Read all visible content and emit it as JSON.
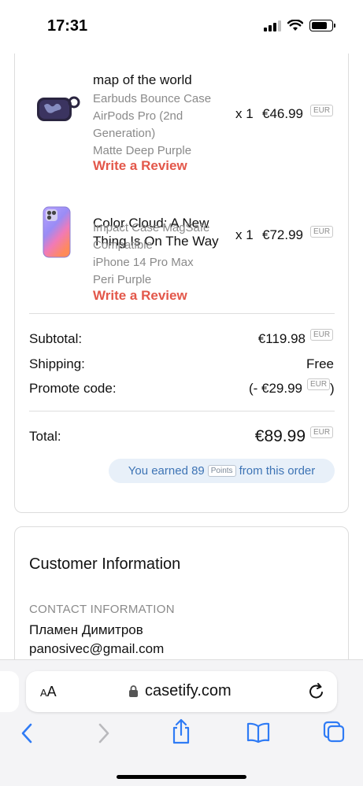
{
  "status_bar": {
    "time": "17:31",
    "battery_level": 0.8
  },
  "order": {
    "items": [
      {
        "title": "map of the world",
        "meta": [
          "Earbuds Bounce Case",
          "AirPods Pro (2nd",
          "Generation)",
          "Matte Deep Purple"
        ],
        "review_label": "Write a Review",
        "qty": "x 1",
        "price": "€46.99",
        "currency": "EUR",
        "thumb_icon": "airpods-case-thumbnail"
      },
      {
        "title_lines": [
          "Color Cloud: A New",
          "Thing Is On The Way"
        ],
        "meta": [
          "Impact Case MagSafe",
          "Compatible",
          "iPhone 14 Pro Max",
          "Peri Purple"
        ],
        "review_label": "Write a Review",
        "qty": "x 1",
        "price": "€72.99",
        "currency": "EUR",
        "thumb_icon": "iphone-case-thumbnail"
      }
    ],
    "summary": {
      "subtotal_label": "Subtotal:",
      "subtotal_value": "€119.98",
      "subtotal_currency": "EUR",
      "shipping_label": "Shipping:",
      "shipping_value": "Free",
      "promo_label": "Promote code:",
      "promo_value": "(- €29.99",
      "promo_currency": "EUR",
      "promo_close": ")",
      "total_label": "Total:",
      "total_value": "€89.99",
      "total_currency": "EUR"
    },
    "points": {
      "prefix": "You earned 89",
      "tag": "Points",
      "suffix": "from this order"
    }
  },
  "customer": {
    "title": "Customer Information",
    "contact_heading": "CONTACT INFORMATION",
    "name": "Пламен Димитров",
    "email": "panosivec@gmail.com"
  },
  "browser": {
    "aa_label": "AA",
    "domain": "casetify.com",
    "colors": {
      "accent": "#2f7bf5",
      "disabled": "#b9b9bd"
    }
  }
}
